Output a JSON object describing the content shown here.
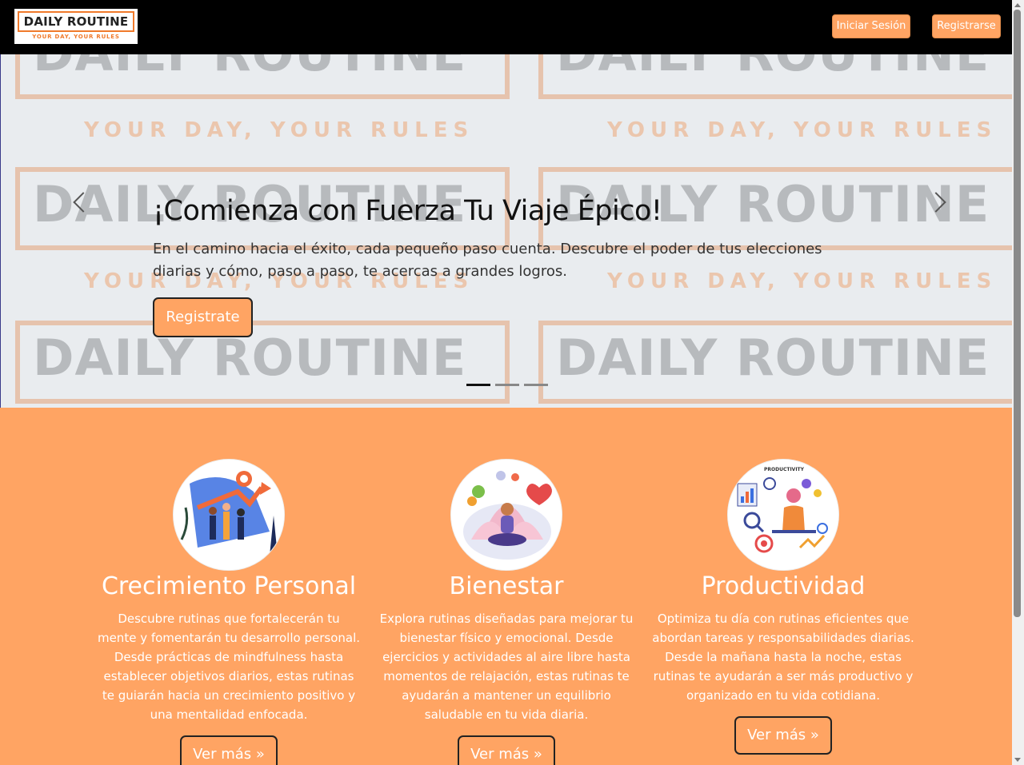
{
  "navbar": {
    "logo_title": "DAILY ROUTINE",
    "logo_subtitle": "YOUR DAY, YOUR RULES",
    "login_label": "Iniciar Sesión",
    "register_label": "Registrarse"
  },
  "carousel": {
    "watermark_title": "DAILY ROUTINE",
    "watermark_subtitle": "YOUR DAY, YOUR RULES",
    "title": "¡Comienza con Fuerza Tu Viaje Épico!",
    "text": "En el camino hacia el éxito, cada pequeño paso cuenta. Descubre el poder de tus elecciones diarias y cómo, paso a paso, te acercas a grandes logros.",
    "button_label": "Registrate",
    "slide_count": 3,
    "active_slide": 1
  },
  "features": [
    {
      "title": "Crecimiento Personal",
      "text": "Descubre rutinas que fortalecerán tu mente y fomentarán tu desarrollo personal. Desde prácticas de mindfulness hasta establecer objetivos diarios, estas rutinas te guiarán hacia un crecimiento positivo y una mentalidad enfocada.",
      "button_label": "Ver más »"
    },
    {
      "title": "Bienestar",
      "text": "Explora rutinas diseñadas para mejorar tu bienestar físico y emocional. Desde ejercicios y actividades al aire libre hasta momentos de relajación, estas rutinas te ayudarán a mantener un equilibrio saludable en tu vida diaria.",
      "button_label": "Ver más »"
    },
    {
      "title": "Productividad",
      "text": "Optimiza tu día con rutinas eficientes que abordan tareas y responsabilidades diarias. Desde la mañana hasta la noche, estas rutinas te ayudarán a ser más productivo y organizado en tu vida cotidiana.",
      "button_label": "Ver más »",
      "image_caption": "PRODUCTIVITY"
    }
  ],
  "colors": {
    "accent": "#ffa463",
    "navbar": "#000000",
    "carousel_bg": "#e9ecef"
  }
}
